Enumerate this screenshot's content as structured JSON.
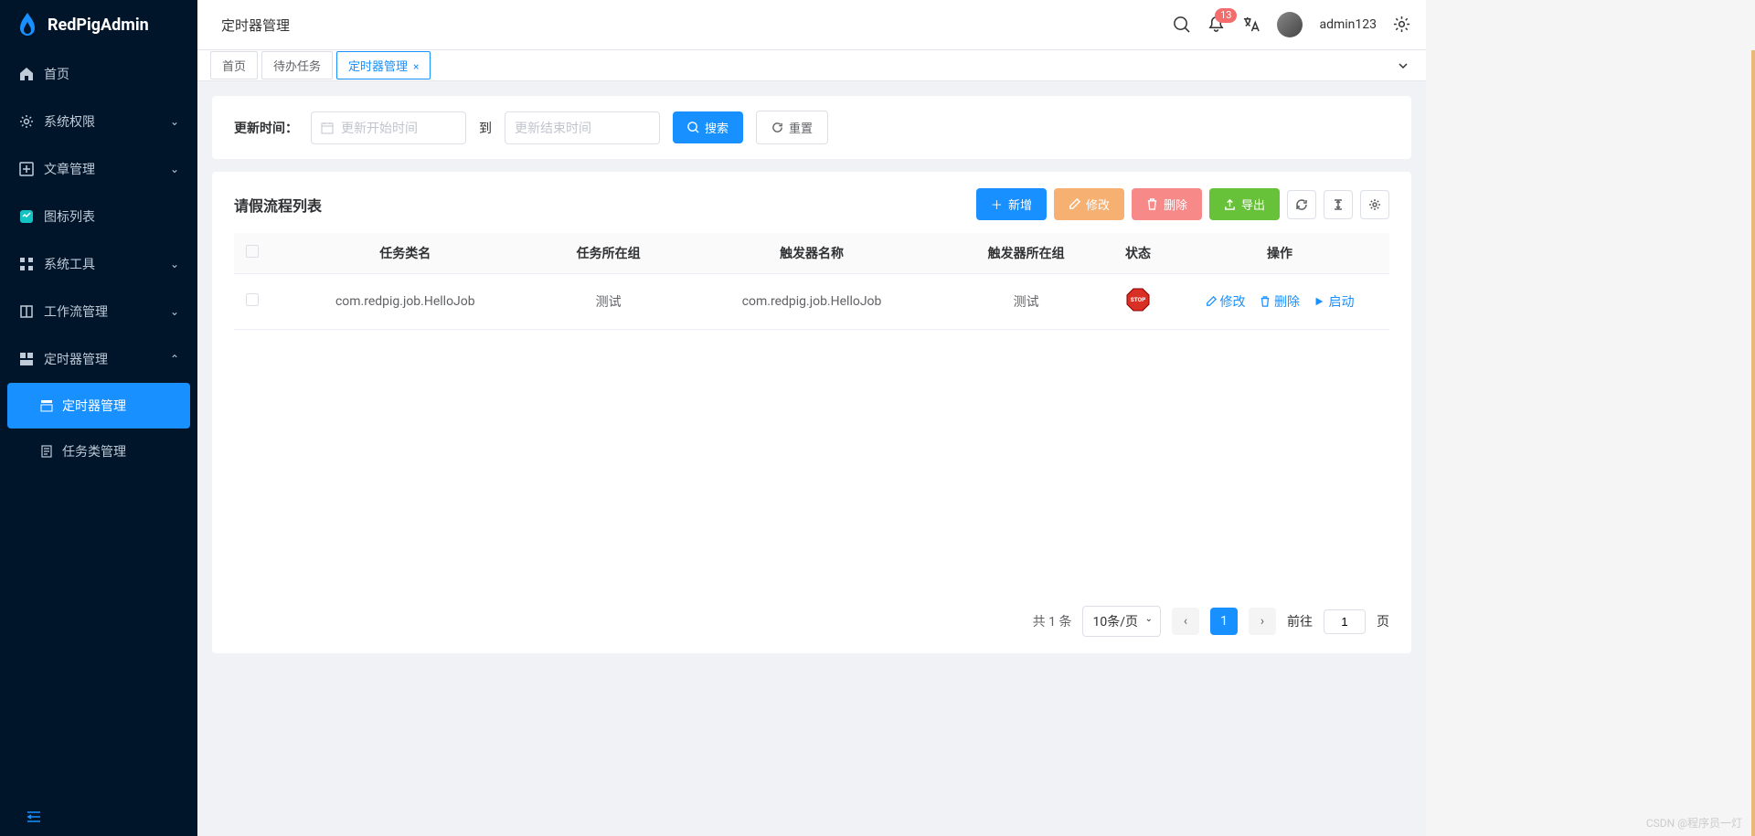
{
  "brand": "RedPigAdmin",
  "header": {
    "title": "定时器管理",
    "badge": "13",
    "username": "admin123"
  },
  "sidebar": {
    "items": [
      {
        "label": "首页",
        "icon": "home",
        "expandable": false
      },
      {
        "label": "系统权限",
        "icon": "gear",
        "expandable": true
      },
      {
        "label": "文章管理",
        "icon": "plus-square",
        "expandable": true
      },
      {
        "label": "图标列表",
        "icon": "grid-badge",
        "expandable": false
      },
      {
        "label": "系统工具",
        "icon": "tools",
        "expandable": true
      },
      {
        "label": "工作流管理",
        "icon": "book",
        "expandable": true
      },
      {
        "label": "定时器管理",
        "icon": "layout",
        "expandable": true,
        "open": true
      }
    ],
    "sub": [
      {
        "label": "定时器管理",
        "active": true
      },
      {
        "label": "任务类管理",
        "active": false
      }
    ]
  },
  "tabs": [
    {
      "label": "首页",
      "active": false,
      "closable": false
    },
    {
      "label": "待办任务",
      "active": false,
      "closable": false
    },
    {
      "label": "定时器管理",
      "active": true,
      "closable": true
    }
  ],
  "filter": {
    "label": "更新时间：",
    "start_placeholder": "更新开始时间",
    "to": "到",
    "end_placeholder": "更新结束时间",
    "search": "搜索",
    "reset": "重置"
  },
  "card": {
    "title": "请假流程列表",
    "add": "新增",
    "edit": "修改",
    "delete": "删除",
    "export": "导出"
  },
  "table": {
    "headers": [
      "任务类名",
      "任务所在组",
      "触发器名称",
      "触发器所在组",
      "状态",
      "操作"
    ],
    "rows": [
      {
        "class": "com.redpig.job.HelloJob",
        "group": "测试",
        "trigger": "com.redpig.job.HelloJob",
        "trigger_group": "测试",
        "status": "STOP"
      }
    ],
    "row_actions": {
      "edit": "修改",
      "delete": "删除",
      "start": "启动"
    }
  },
  "pagination": {
    "total_prefix": "共",
    "total": "1",
    "total_suffix": "条",
    "per_page": "10条/页",
    "current": "1",
    "goto": "前往",
    "goto_value": "1",
    "page_suffix": "页"
  },
  "watermark": "CSDN @程序员一灯"
}
